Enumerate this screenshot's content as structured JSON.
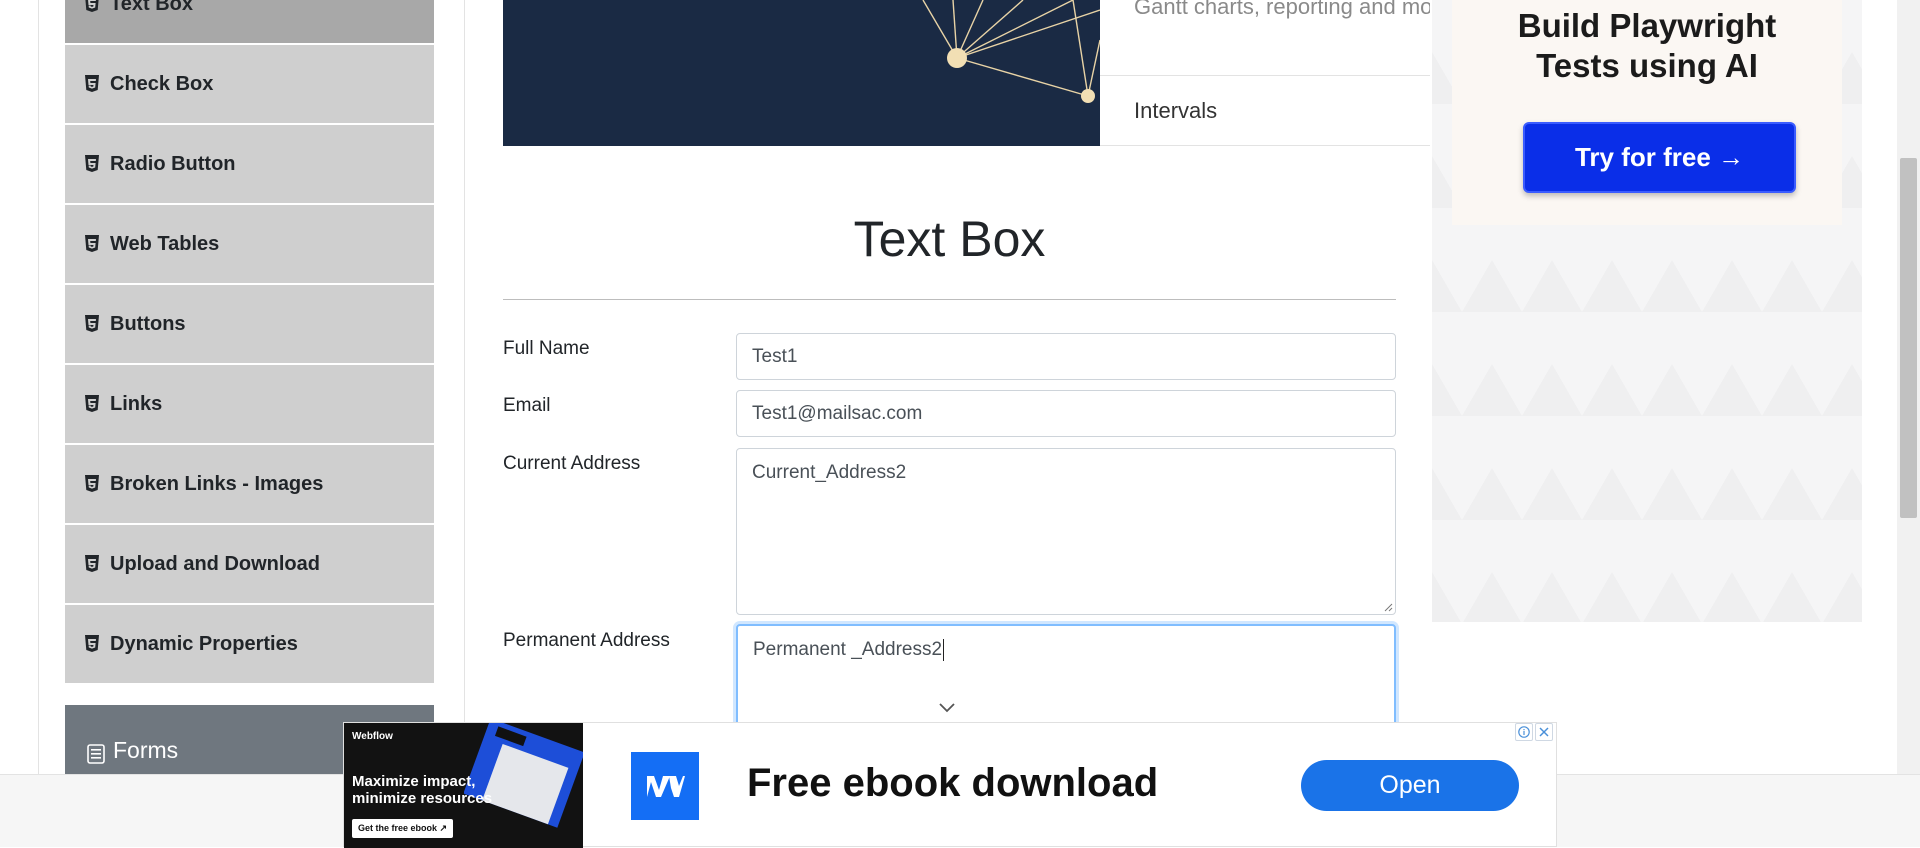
{
  "sidebar": {
    "items": [
      {
        "label": "Text Box",
        "icon": "html5-icon",
        "active": true
      },
      {
        "label": "Check Box",
        "icon": "html5-icon"
      },
      {
        "label": "Radio Button",
        "icon": "html5-icon"
      },
      {
        "label": "Web Tables",
        "icon": "html5-icon"
      },
      {
        "label": "Buttons",
        "icon": "html5-icon"
      },
      {
        "label": "Links",
        "icon": "html5-icon"
      },
      {
        "label": "Broken Links - Images",
        "icon": "html5-icon"
      },
      {
        "label": "Upload and Download",
        "icon": "html5-icon"
      },
      {
        "label": "Dynamic Properties",
        "icon": "html5-icon"
      }
    ],
    "group": {
      "label": "Forms",
      "icon": "list-icon"
    }
  },
  "banner": {
    "description": "Gantt charts, reporting and mo",
    "link": "Intervals"
  },
  "main": {
    "title": "Text Box",
    "fields": {
      "full_name": {
        "label": "Full Name",
        "value": "Test1"
      },
      "email": {
        "label": "Email",
        "value": "Test1@mailsac.com"
      },
      "current_address": {
        "label": "Current Address",
        "value": "Current_Address2"
      },
      "permanent_address": {
        "label": "Permanent Address",
        "value": "Permanent _Address2"
      }
    }
  },
  "right_ad": {
    "headline_line1": "Build Playwright",
    "headline_line2": "Tests using AI",
    "cta": "Try for free →",
    "cta_color": "#0a2ee8"
  },
  "bottom_ad": {
    "brand": "Webflow",
    "tagline": "Maximize impact, minimize resources",
    "mini_cta": "Get the free ebook ↗",
    "text": "Free ebook download",
    "button": "Open",
    "button_color": "#1a73e8"
  }
}
